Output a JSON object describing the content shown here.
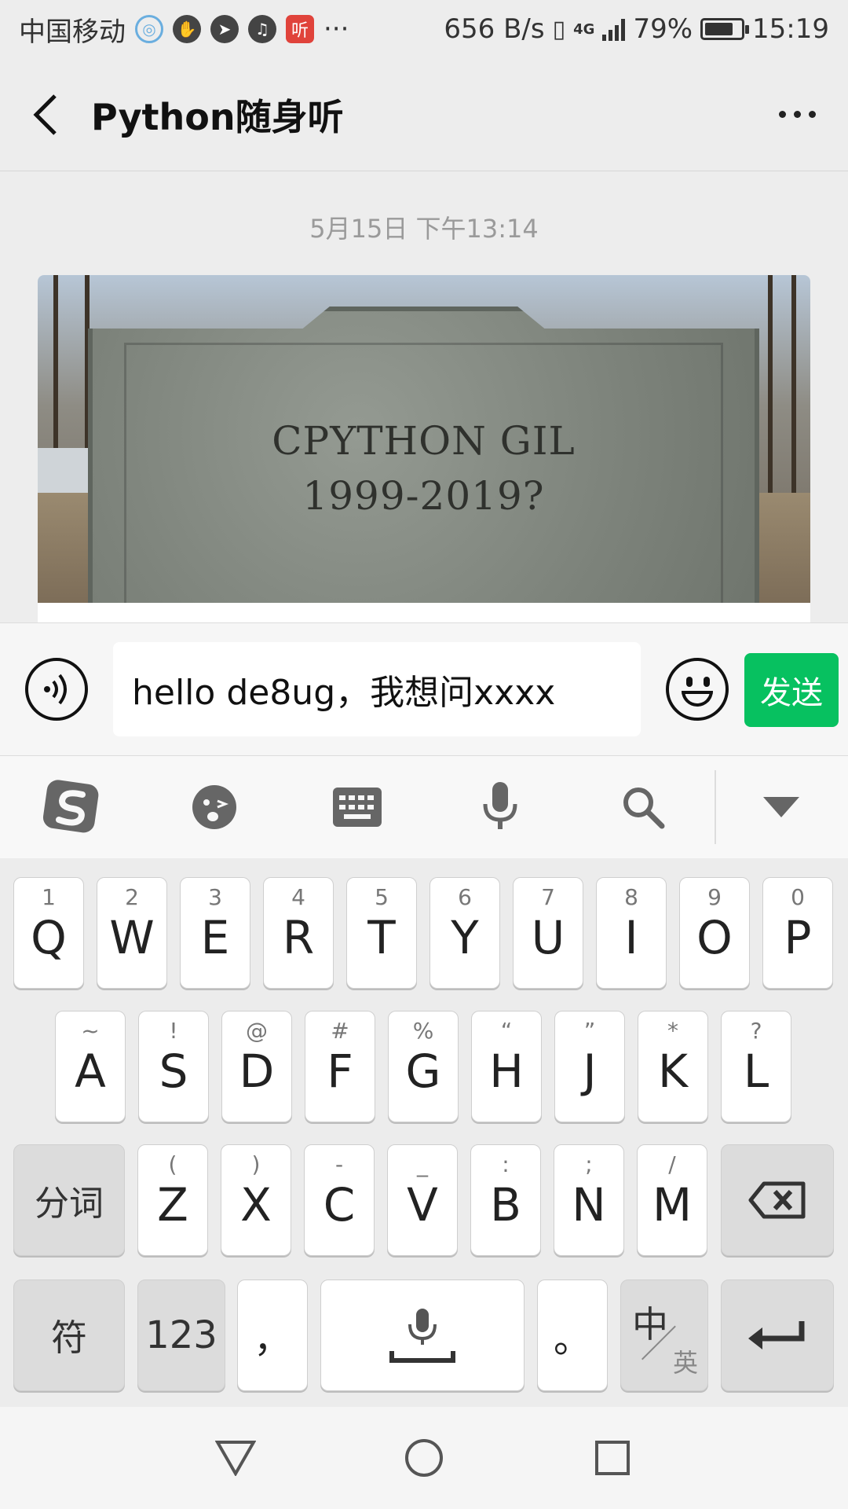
{
  "status_bar": {
    "carrier": "中国移动",
    "app_icons": [
      "qq-icon",
      "hand-icon",
      "send-icon",
      "audio-icon",
      "ting-icon"
    ],
    "ting_label": "听",
    "overflow": "···",
    "net_speed": "656 B/s",
    "network": "4G",
    "battery": "79%",
    "battery_level": 0.79,
    "time": "15:19"
  },
  "header": {
    "title": "Python随身听"
  },
  "chat": {
    "timestamp": "5月15日 下午13:14",
    "image_text_line1": "CPYTHON GIL",
    "image_text_line2": "1999-2019?"
  },
  "input_bar": {
    "text": "hello de8ug，我想问xxxx",
    "send_label": "发送"
  },
  "ime_toolbar": {
    "items": [
      "sogou-logo-icon",
      "emoji-face-icon",
      "keyboard-icon",
      "microphone-icon",
      "search-icon",
      "collapse-icon"
    ]
  },
  "keyboard": {
    "row1": [
      {
        "main": "Q",
        "sub": "1"
      },
      {
        "main": "W",
        "sub": "2"
      },
      {
        "main": "E",
        "sub": "3"
      },
      {
        "main": "R",
        "sub": "4"
      },
      {
        "main": "T",
        "sub": "5"
      },
      {
        "main": "Y",
        "sub": "6"
      },
      {
        "main": "U",
        "sub": "7"
      },
      {
        "main": "I",
        "sub": "8"
      },
      {
        "main": "O",
        "sub": "9"
      },
      {
        "main": "P",
        "sub": "0"
      }
    ],
    "row2": [
      {
        "main": "A",
        "sub": "~"
      },
      {
        "main": "S",
        "sub": "!"
      },
      {
        "main": "D",
        "sub": "@"
      },
      {
        "main": "F",
        "sub": "#"
      },
      {
        "main": "G",
        "sub": "%"
      },
      {
        "main": "H",
        "sub": "“"
      },
      {
        "main": "J",
        "sub": "”"
      },
      {
        "main": "K",
        "sub": "*"
      },
      {
        "main": "L",
        "sub": "?"
      }
    ],
    "row3": [
      {
        "main": "Z",
        "sub": "("
      },
      {
        "main": "X",
        "sub": ")"
      },
      {
        "main": "C",
        "sub": "-"
      },
      {
        "main": "V",
        "sub": "_"
      },
      {
        "main": "B",
        "sub": ":"
      },
      {
        "main": "N",
        "sub": ";"
      },
      {
        "main": "M",
        "sub": "/"
      }
    ],
    "fenci": "分词",
    "fu": "符",
    "num": "123",
    "comma": "，",
    "period": "。",
    "lang_zh": "中",
    "lang_en": "英"
  }
}
